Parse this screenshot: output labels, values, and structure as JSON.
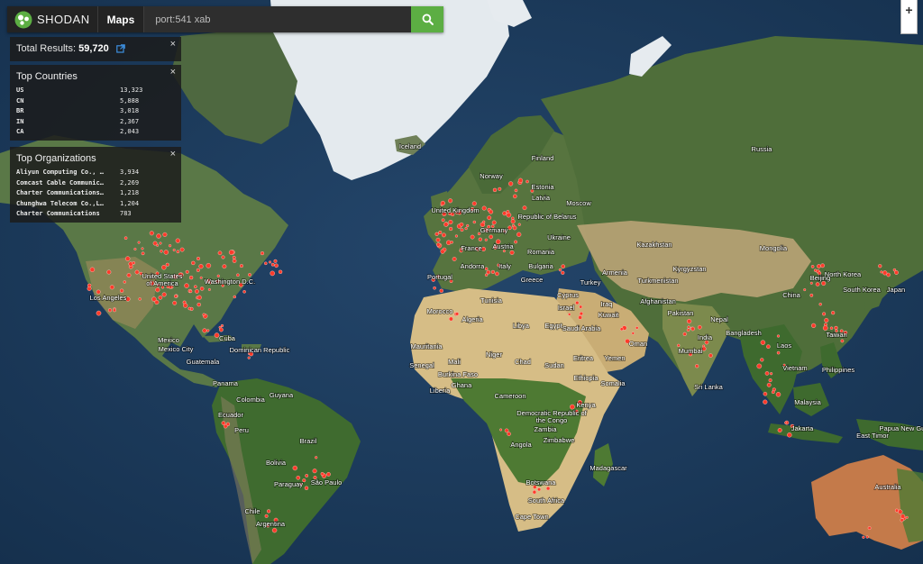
{
  "app": {
    "brand": "SHODAN",
    "nav_label": "Maps"
  },
  "search": {
    "value": "port:541 xab",
    "button_icon": "search-icon"
  },
  "zoom": {
    "in_label": "+"
  },
  "total": {
    "label": "Total Results:",
    "value": "59,720",
    "link_icon": "external-link-icon",
    "close": "×"
  },
  "top_countries": {
    "title": "Top Countries",
    "close": "×",
    "rows": [
      {
        "key": "US",
        "value": "13,323"
      },
      {
        "key": "CN",
        "value": "5,888"
      },
      {
        "key": "BR",
        "value": "3,018"
      },
      {
        "key": "IN",
        "value": "2,367"
      },
      {
        "key": "CA",
        "value": "2,043"
      }
    ]
  },
  "top_orgs": {
    "title": "Top Organizations",
    "close": "×",
    "rows": [
      {
        "key": "Aliyun Computing Co., …",
        "value": "3,934"
      },
      {
        "key": "Comcast Cable Communic…",
        "value": "2,269"
      },
      {
        "key": "Charter Communications…",
        "value": "1,218"
      },
      {
        "key": "Chunghwa Telecom Co.,L…",
        "value": "1,204"
      },
      {
        "key": "Charter Communications",
        "value": "783"
      }
    ]
  },
  "map_labels": [
    "Iceland",
    "Finland",
    "Norway",
    "Estonia",
    "Latvia",
    "Moscow",
    "United Kingdom",
    "Republic of Belarus",
    "Germany",
    "Ukraine",
    "France",
    "Austria",
    "Romania",
    "Andorra",
    "Portugal",
    "Italy",
    "Bulgaria",
    "Greece",
    "Kazakhstan",
    "Mongolia",
    "Russia",
    "Kyrgyzstan",
    "Armenia",
    "Turkmenistan",
    "Tunisia",
    "Turkey",
    "Cyprus",
    "Iraq",
    "Afghanistan",
    "Morocco",
    "Algeria",
    "Libya",
    "Israel",
    "Kuwait",
    "Pakistan",
    "Nepal",
    "Saudi Arabia",
    "Egypt",
    "Oman",
    "Mauritania",
    "India",
    "Bangladesh",
    "Mali",
    "Niger",
    "Chad",
    "Sudan",
    "Eritrea",
    "Yemen",
    "Mumbai",
    "Laos",
    "Senegal",
    "Burkina Faso",
    "Ethiopia",
    "Sri Lanka",
    "Vietnam",
    "Liberia",
    "Ghana",
    "Cameroon",
    "Somalia",
    "Democratic Republic of the Congo",
    "Kenya",
    "Philippines",
    "Taiwan",
    "Malaysia",
    "Angola",
    "Zambia",
    "Zimbabwe",
    "Madagascar",
    "Botswana",
    "South Africa",
    "Cape Town",
    "Jakarta",
    "East Timor",
    "Papua New Guinea",
    "Australia",
    "China",
    "North Korea",
    "South Korea",
    "Japan",
    "Beijing",
    "United States of America",
    "Los Angeles",
    "Washington D.C.",
    "Mexico",
    "Mexico City",
    "Cuba",
    "Dominican Republic",
    "Guatemala",
    "Panama",
    "Colombia",
    "Guyana",
    "Ecuador",
    "Peru",
    "Brazil",
    "Bolivia",
    "Paraguay",
    "São Paulo",
    "Chile",
    "Argentina"
  ],
  "colors": {
    "ocean": "#1b3a5c",
    "land": "#5e7d4a",
    "desert": "#c8ab72",
    "ice": "#e9eef2",
    "marker": "#ff3a2a",
    "search_button": "#5cae43",
    "topbar": "#232323"
  }
}
